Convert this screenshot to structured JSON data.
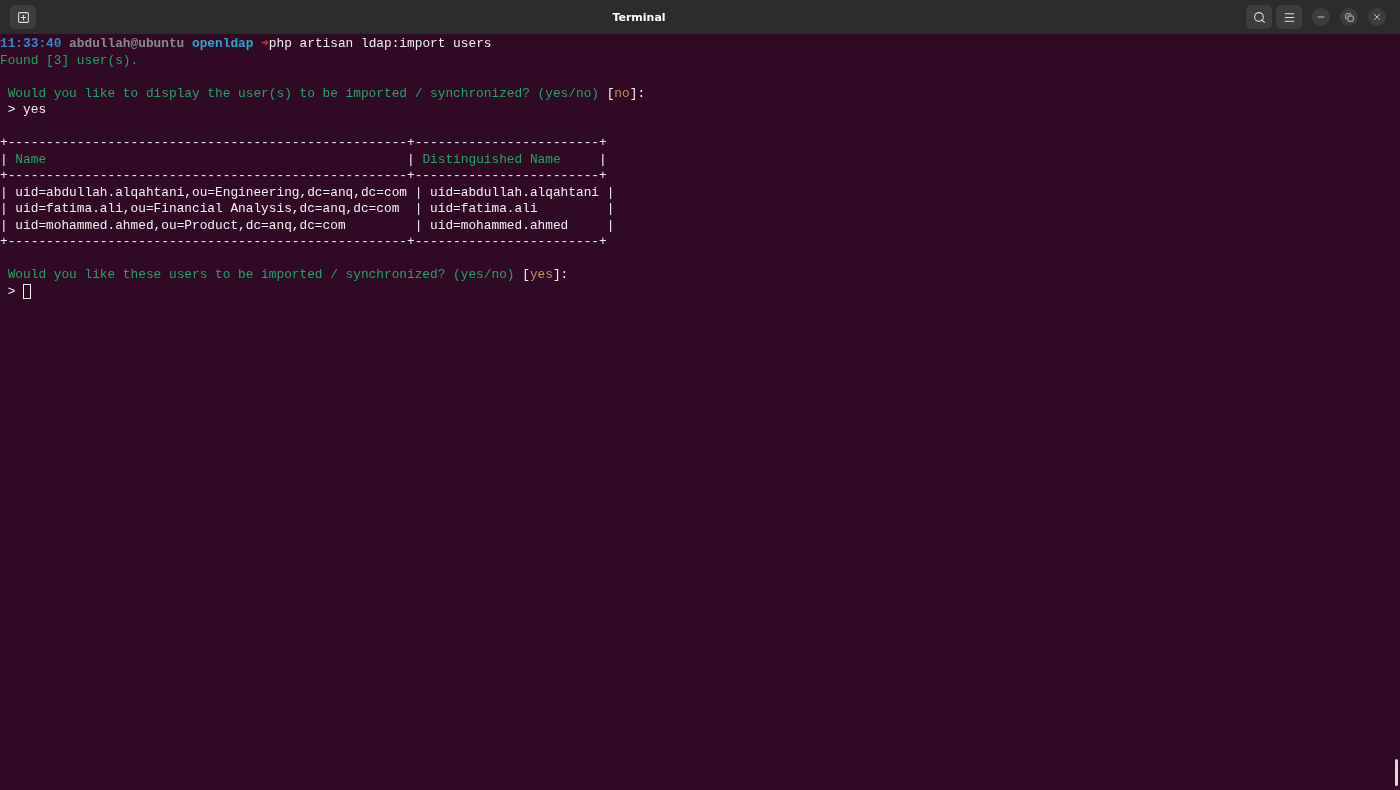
{
  "window": {
    "title": "Terminal"
  },
  "lines": [
    {
      "kind": "text",
      "cursor": false,
      "segments": [
        {
          "kind": "time",
          "text": "11:33:40"
        },
        {
          "kind": "user",
          "text": "abdullah@ubuntu"
        },
        {
          "kind": "dir",
          "text": "openldap"
        },
        {
          "kind": "arrow",
          "text": "➜"
        },
        {
          "kind": "command",
          "text": "php artisan ldap:import users"
        }
      ]
    },
    {
      "kind": "text",
      "cursor": false,
      "segments": [
        {
          "kind": "info",
          "text": "Found [3] user(s)."
        }
      ]
    },
    {
      "kind": "blank"
    },
    {
      "kind": "text",
      "cursor": false,
      "segments": [
        {
          "kind": "question",
          "text": " Would you like to display the user(s) to be imported / synchronized? (yes/no)"
        },
        {
          "kind": "plain",
          "text": " ["
        },
        {
          "kind": "default",
          "text": "no"
        },
        {
          "kind": "plain",
          "text": "]:"
        }
      ]
    },
    {
      "kind": "text",
      "cursor": false,
      "segments": [
        {
          "kind": "input",
          "text": " > yes"
        }
      ]
    },
    {
      "kind": "blank"
    },
    {
      "kind": "text",
      "cursor": false,
      "segments": [
        {
          "kind": "border",
          "text": "+----------------------------------------------------+------------------------+"
        }
      ]
    },
    {
      "kind": "text",
      "cursor": false,
      "segments": [
        {
          "kind": "plain",
          "text": "| "
        },
        {
          "kind": "heading",
          "text": "Name"
        },
        {
          "kind": "plain",
          "text": "                                               | "
        },
        {
          "kind": "heading",
          "text": "Distinguished Name"
        },
        {
          "kind": "plain",
          "text": "     |"
        }
      ]
    },
    {
      "kind": "text",
      "cursor": false,
      "segments": [
        {
          "kind": "border",
          "text": "+----------------------------------------------------+------------------------+"
        }
      ]
    },
    {
      "kind": "text",
      "cursor": false,
      "segments": [
        {
          "kind": "row",
          "text": "| uid=abdullah.alqahtani,ou=Engineering,dc=anq,dc=com | uid=abdullah.alqahtani |"
        }
      ]
    },
    {
      "kind": "text",
      "cursor": false,
      "segments": [
        {
          "kind": "row",
          "text": "| uid=fatima.ali,ou=Financial Analysis,dc=anq,dc=com  | uid=fatima.ali         |"
        }
      ]
    },
    {
      "kind": "text",
      "cursor": false,
      "segments": [
        {
          "kind": "row",
          "text": "| uid=mohammed.ahmed,ou=Product,dc=anq,dc=com         | uid=mohammed.ahmed     |"
        }
      ]
    },
    {
      "kind": "text",
      "cursor": false,
      "segments": [
        {
          "kind": "border",
          "text": "+----------------------------------------------------+------------------------+"
        }
      ]
    },
    {
      "kind": "blank"
    },
    {
      "kind": "text",
      "cursor": false,
      "segments": [
        {
          "kind": "question",
          "text": " Would you like these users to be imported / synchronized? (yes/no)"
        },
        {
          "kind": "plain",
          "text": " ["
        },
        {
          "kind": "default",
          "text": "yes"
        },
        {
          "kind": "plain",
          "text": "]:"
        }
      ]
    },
    {
      "kind": "text",
      "cursor": true,
      "segments": [
        {
          "kind": "input",
          "text": " >"
        }
      ]
    }
  ]
}
